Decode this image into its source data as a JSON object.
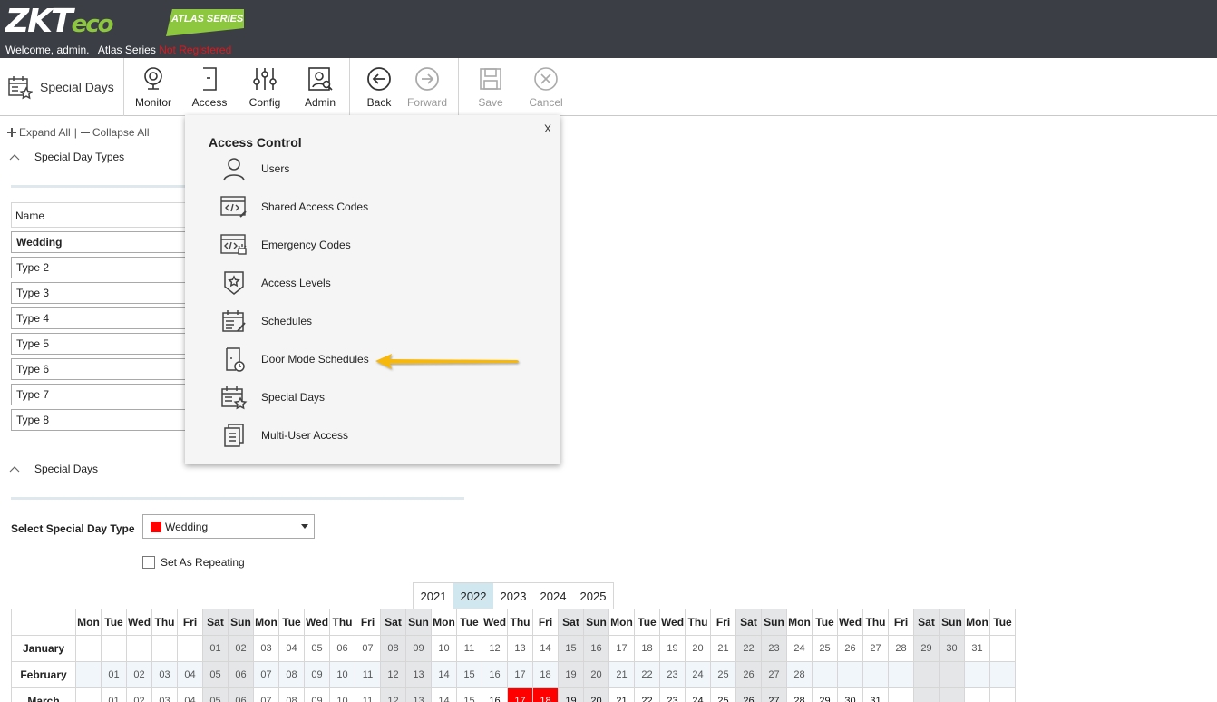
{
  "header": {
    "logo_main": "ZKT",
    "logo_eco": "eco",
    "series_badge": "ATLAS SERIES",
    "welcome": "Welcome, admin.",
    "series": "Atlas Series",
    "registration": "Not Registered"
  },
  "toolbar": {
    "page_title": "Special Days",
    "buttons": [
      {
        "label": "Monitor"
      },
      {
        "label": "Access"
      },
      {
        "label": "Config"
      },
      {
        "label": "Admin"
      },
      {
        "label": "Back"
      },
      {
        "label": "Forward"
      },
      {
        "label": "Save"
      },
      {
        "label": "Cancel"
      }
    ]
  },
  "tree": {
    "expand_all": "Expand All",
    "collapse_all": "Collapse All",
    "separator": "|"
  },
  "types_section": {
    "title": "Special Day Types",
    "column": "Name",
    "rows": [
      "Wedding",
      "Type 2",
      "Type 3",
      "Type 4",
      "Type 5",
      "Type 6",
      "Type 7",
      "Type 8"
    ]
  },
  "days_section": {
    "title": "Special Days",
    "select_label": "Select Special Day Type",
    "selected_type": "Wedding",
    "selected_color": "#ff0000",
    "repeat_label": "Set As Repeating",
    "years": [
      "2021",
      "2022",
      "2023",
      "2024",
      "2025"
    ],
    "active_year": "2022",
    "weekday_headers": [
      "Mon",
      "Tue",
      "Wed",
      "Thu",
      "Fri",
      "Sat",
      "Sun",
      "Mon",
      "Tue",
      "Wed",
      "Thu",
      "Fri",
      "Sat",
      "Sun",
      "Mon",
      "Tue",
      "Wed",
      "Thu",
      "Fri",
      "Sat",
      "Sun",
      "Mon",
      "Tue",
      "Wed",
      "Thu",
      "Fri",
      "Sat",
      "Sun",
      "Mon",
      "Tue",
      "Wed",
      "Thu",
      "Fri",
      "Sat",
      "Sun",
      "Mon",
      "Tue"
    ],
    "months": [
      {
        "name": "January",
        "offset": 5,
        "days": 31
      },
      {
        "name": "February",
        "offset": 1,
        "days": 28
      },
      {
        "name": "March",
        "offset": 1,
        "days": 31
      }
    ],
    "selected_days": [
      {
        "month": "March",
        "day": 17
      },
      {
        "month": "March",
        "day": 18
      }
    ]
  },
  "popup": {
    "close": "X",
    "title": "Access Control",
    "items": [
      {
        "label": "Users",
        "icon": "user-icon"
      },
      {
        "label": "Shared Access Codes",
        "icon": "shared-code-icon"
      },
      {
        "label": "Emergency Codes",
        "icon": "emergency-code-icon"
      },
      {
        "label": "Access Levels",
        "icon": "shield-star-icon"
      },
      {
        "label": "Schedules",
        "icon": "calendar-edit-icon"
      },
      {
        "label": "Door Mode Schedules",
        "icon": "door-clock-icon"
      },
      {
        "label": "Special Days",
        "icon": "calendar-star-icon"
      },
      {
        "label": "Multi-User Access",
        "icon": "documents-icon"
      }
    ]
  }
}
